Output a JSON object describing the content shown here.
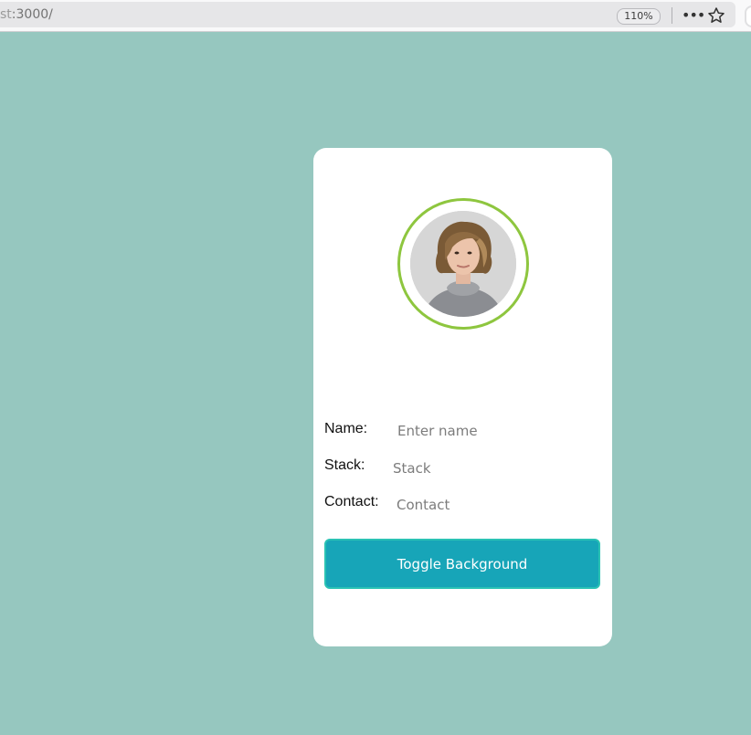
{
  "browser": {
    "url_host": "st",
    "url_path": ":3000/",
    "zoom": "110%",
    "icons": {
      "more": "more-options-icon",
      "bookmark": "bookmark-star-icon"
    }
  },
  "card": {
    "avatar": {
      "icon": "user-photo",
      "ring_color": "#8ec63f"
    },
    "fields": {
      "name": {
        "label": "Name:",
        "placeholder": "Enter name",
        "value": ""
      },
      "stack": {
        "label": "Stack:",
        "placeholder": "Stack",
        "value": ""
      },
      "contact": {
        "label": "Contact:",
        "placeholder": "Contact",
        "value": ""
      }
    },
    "toggle_button": {
      "label": "Toggle Background",
      "color": "#17a5b8"
    }
  },
  "colors": {
    "page_background": "#96c7bf",
    "card_background": "#ffffff"
  }
}
